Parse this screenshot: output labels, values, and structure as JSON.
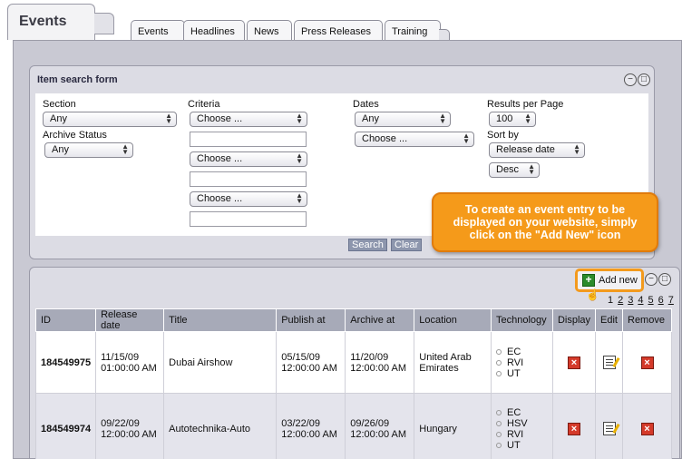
{
  "app": {
    "main_tab": "Events"
  },
  "subtabs": [
    "Events",
    "Headlines",
    "News",
    "Press Releases",
    "Training"
  ],
  "search_form": {
    "title": "Item search form",
    "section_label": "Section",
    "section_value": "Any",
    "archive_label": "Archive Status",
    "archive_value": "Any",
    "criteria_label": "Criteria",
    "criteria_values": [
      "Choose ...",
      "Choose ...",
      "Choose ..."
    ],
    "dates_label": "Dates",
    "dates_value": "Any",
    "dates_choose": "Choose ...",
    "rpp_label": "Results per Page",
    "rpp_value": "100",
    "sort_label": "Sort by",
    "sort_value": "Release date",
    "order_value": "Desc",
    "search_btn": "Search",
    "clear_btn": "Clear"
  },
  "callout": "To create an event entry to be displayed on your website, simply click on the \"Add New\" icon",
  "list": {
    "add_new": "Add new",
    "pages": [
      "1",
      "2",
      "3",
      "4",
      "5",
      "6",
      "7"
    ],
    "columns": [
      "ID",
      "Release date",
      "Title",
      "Publish at",
      "Archive at",
      "Location",
      "Technology",
      "Display",
      "Edit",
      "Remove"
    ],
    "rows": [
      {
        "id": "184549975",
        "release_date": "11/15/09",
        "release_time": "01:00:00 AM",
        "title": "Dubai Airshow",
        "publish_date": "05/15/09",
        "publish_time": "12:00:00 AM",
        "archive_date": "11/20/09",
        "archive_time": "12:00:00 AM",
        "location": "United Arab Emirates",
        "tech": [
          "EC",
          "RVI",
          "UT"
        ]
      },
      {
        "id": "184549974",
        "release_date": "09/22/09",
        "release_time": "12:00:00 AM",
        "title": "Autotechnika-Auto",
        "publish_date": "03/22/09",
        "publish_time": "12:00:00 AM",
        "archive_date": "09/26/09",
        "archive_time": "12:00:00 AM",
        "location": "Hungary",
        "tech": [
          "EC",
          "HSV",
          "RVI",
          "UT"
        ]
      }
    ]
  },
  "colors": {
    "accent": "#f59a1a",
    "header_cell": "#a7aab8",
    "panel": "#dcdce4"
  }
}
